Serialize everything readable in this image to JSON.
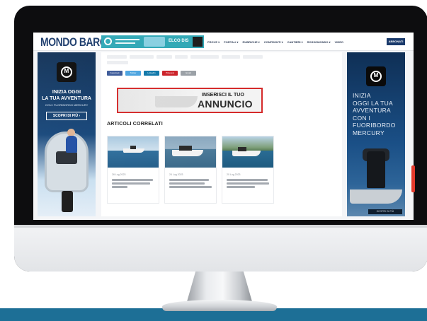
{
  "site": {
    "logo_text": "MONDO BARCA",
    "top_ad_text": "ELCO DIS",
    "nav": [
      "PROVE ▾",
      "PORTALI ▾",
      "RUBRICHE ▾",
      "CONFRONTI ▾",
      "CANTIERI ▾",
      "ROSSOMONDO ▾",
      "VIDEO"
    ],
    "subscribe_label": "ABBONATI"
  },
  "left_ad": {
    "brand_mark": "M",
    "title_line1": "INIZIA OGGI",
    "title_line2": "LA TUA AVVENTURA",
    "subtitle": "CON I FUORIBORDO MERCURY",
    "cta_label": "SCOPRI DI PIÙ  ›"
  },
  "right_ad": {
    "brand_mark": "M",
    "title_lines": [
      "INIZIA",
      "OGGI LA TUA",
      "AVVENTURA",
      "CON I",
      "FUORIBORDO",
      "MERCURY"
    ],
    "bar_text": "SCOPRI DI PIÙ"
  },
  "article": {
    "share_buttons": [
      "Facebook",
      "Twitter",
      "LinkedIn",
      "Pinterest",
      "Email"
    ],
    "share_colors": [
      "#3b5998",
      "#4aa3df",
      "#0e76a8",
      "#cb2027",
      "#9aa0a6"
    ],
    "promo": {
      "line1": "INSERISCI IL TUO",
      "line2": "ANNUNCIO"
    },
    "related_title": "ARTICOLI CORRELATI",
    "cards": [
      {
        "date": "26 Lug 2023"
      },
      {
        "date": "24 Lug 2023"
      },
      {
        "date": "20 Lug 2023"
      }
    ]
  },
  "colors": {
    "brand_navy": "#1a3a6b",
    "band": "#1d6f96",
    "promo_border": "#d52b2b",
    "scroll_accent": "#e33a2c"
  }
}
